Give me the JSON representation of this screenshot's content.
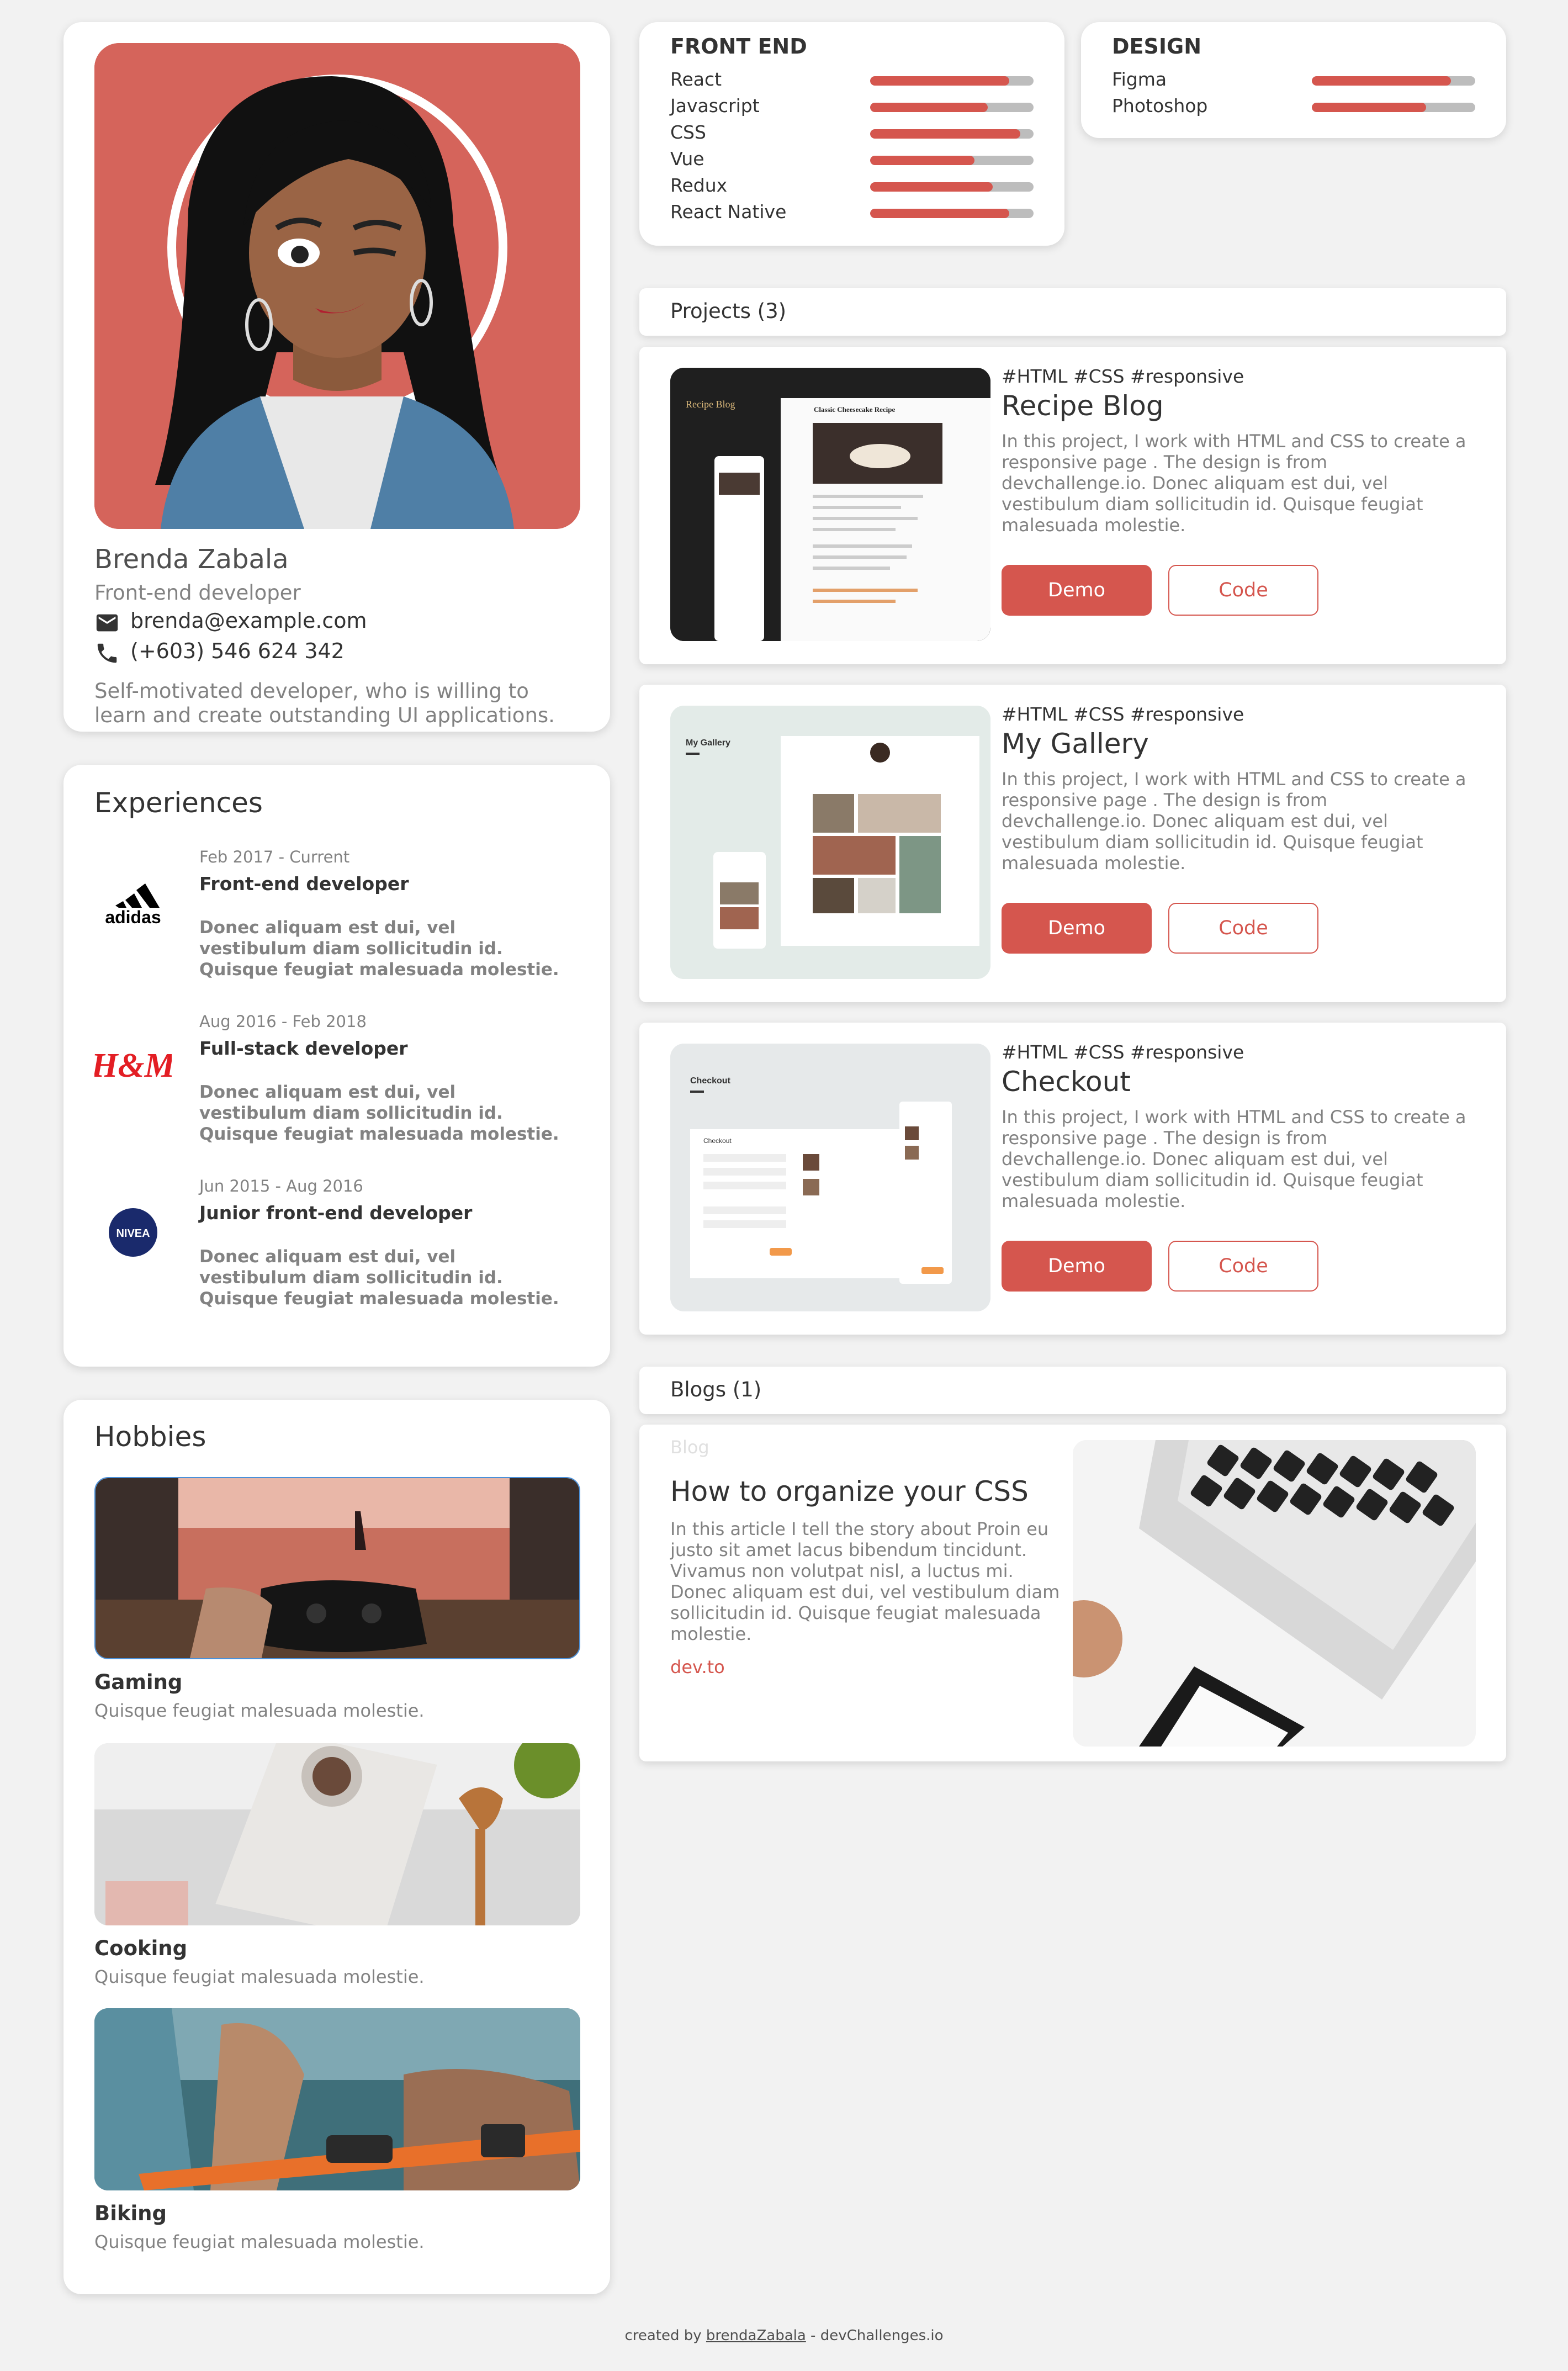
{
  "profile": {
    "name": "Brenda Zabala",
    "role": "Front-end developer",
    "email": "brenda@example.com",
    "phone": "(+603) 546 624 342",
    "bio": "Self-motivated developer, who is willing to learn and create outstanding UI applications.",
    "email_icon": "mail-icon",
    "phone_icon": "phone-icon"
  },
  "skills": {
    "front_end": {
      "title": "FRONT END",
      "items": [
        {
          "label": "React",
          "level": 0.85
        },
        {
          "label": "Javascript",
          "level": 0.72
        },
        {
          "label": "CSS",
          "level": 0.92
        },
        {
          "label": "Vue",
          "level": 0.64
        },
        {
          "label": "Redux",
          "level": 0.75
        },
        {
          "label": "React Native",
          "level": 0.85
        }
      ]
    },
    "design": {
      "title": "DESIGN",
      "items": [
        {
          "label": "Figma",
          "level": 0.85
        },
        {
          "label": "Photoshop",
          "level": 0.7
        }
      ]
    }
  },
  "projects": {
    "header": "Projects (3)",
    "items": [
      {
        "tags": "#HTML  #CSS  #responsive",
        "title": "Recipe Blog",
        "description": "In this project, I work with HTML and CSS to create a responsive page . The design is from devchallenge.io. Donec aliquam est dui, vel vestibulum diam sollicitudin id. Quisque feugiat malesuada molestie.",
        "demo": "Demo",
        "code": "Code",
        "thumb_heading": "Recipe Blog",
        "thumb_sub": "Classic Cheesecake Recipe"
      },
      {
        "tags": "#HTML  #CSS  #responsive",
        "title": "My Gallery",
        "description": "In this project, I work with HTML and CSS to create a responsive page . The design is from devchallenge.io. Donec aliquam est dui, vel vestibulum diam sollicitudin id. Quisque feugiat malesuada molestie.",
        "demo": "Demo",
        "code": "Code",
        "thumb_heading": "My Gallery",
        "thumb_sub": ""
      },
      {
        "tags": "#HTML  #CSS  #responsive",
        "title": "Checkout",
        "description": "In this project, I work with HTML and CSS to create a responsive page . The design is from devchallenge.io. Donec aliquam est dui, vel vestibulum diam sollicitudin id. Quisque feugiat malesuada molestie.",
        "demo": "Demo",
        "code": "Code",
        "thumb_heading": "Checkout",
        "thumb_sub": "Checkout"
      }
    ]
  },
  "blogs": {
    "header": "Blogs (1)",
    "kicker": "Blog",
    "title": "How to organize your CSS",
    "description": "In this article I tell the story about Proin eu justo sit amet lacus bibendum tincidunt. Vivamus non volutpat nisl, a luctus mi. Donec aliquam est dui, vel vestibulum diam sollicitudin id. Quisque feugiat malesuada molestie.",
    "link": "dev.to"
  },
  "experiences": {
    "title": "Experiences",
    "items": [
      {
        "logo": "adidas",
        "date": "Feb 2017 - Current",
        "role": "Front-end developer",
        "description": "Donec aliquam est dui, vel vestibulum diam sollicitudin id. Quisque feugiat malesuada molestie."
      },
      {
        "logo": "H&M",
        "date": "Aug 2016 - Feb 2018",
        "role": "Full-stack developer",
        "description": "Donec aliquam est dui, vel vestibulum diam sollicitudin id. Quisque feugiat malesuada molestie."
      },
      {
        "logo": "NIVEA",
        "date": "Jun 2015 - Aug 2016",
        "role": "Junior front-end developer",
        "description": "Donec aliquam est dui, vel vestibulum diam sollicitudin id. Quisque feugiat malesuada molestie."
      }
    ]
  },
  "hobbies": {
    "title": "Hobbies",
    "items": [
      {
        "name": "Gaming",
        "description": "Quisque feugiat malesuada molestie."
      },
      {
        "name": "Cooking",
        "description": "Quisque feugiat malesuada molestie."
      },
      {
        "name": "Biking",
        "description": "Quisque feugiat malesuada molestie."
      }
    ]
  },
  "footer": {
    "prefix": "created by ",
    "author": "brendaZabala",
    "suffix": " - devChallenges.io"
  },
  "colors": {
    "accent": "#d5564e",
    "portrait_bg": "#d5645b",
    "track": "#bdbdbd",
    "page_bg": "#f2f2f2"
  }
}
